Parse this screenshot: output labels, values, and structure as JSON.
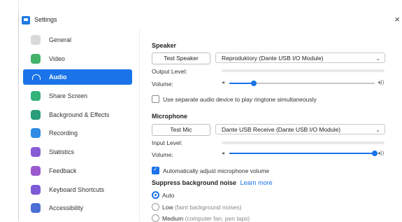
{
  "window": {
    "title": "Settings",
    "close_glyph": "×"
  },
  "sidebar": {
    "items": [
      {
        "label": "General",
        "icon": "gear-icon",
        "color": "#d9d9d9"
      },
      {
        "label": "Video",
        "icon": "video-icon",
        "color": "#42b36a"
      },
      {
        "label": "Audio",
        "icon": "headphones-icon",
        "color": "#1a73e8",
        "active": true
      },
      {
        "label": "Share Screen",
        "icon": "share-screen-icon",
        "color": "#33b37a"
      },
      {
        "label": "Background & Effects",
        "icon": "background-icon",
        "color": "#2a9d7a"
      },
      {
        "label": "Recording",
        "icon": "recording-icon",
        "color": "#2f8be6"
      },
      {
        "label": "Statistics",
        "icon": "statistics-icon",
        "color": "#8a5bd6"
      },
      {
        "label": "Feedback",
        "icon": "feedback-icon",
        "color": "#9b59d0"
      },
      {
        "label": "Keyboard Shortcuts",
        "icon": "keyboard-icon",
        "color": "#7d5bd6"
      },
      {
        "label": "Accessibility",
        "icon": "accessibility-icon",
        "color": "#4c6fd6"
      }
    ]
  },
  "speaker": {
    "section_title": "Speaker",
    "test_button": "Test Speaker",
    "device": "Reproduktory (Dante USB I/O Module)",
    "output_level_label": "Output Level:",
    "output_level": 0.0,
    "volume_label": "Volume:",
    "volume": 0.17,
    "separate_device_label": "Use separate audio device to play ringtone simultaneously",
    "separate_device_checked": false
  },
  "microphone": {
    "section_title": "Microphone",
    "test_button": "Test Mic",
    "device": "Dante USB Receive (Dante USB I/O Module)",
    "input_level_label": "Input Level:",
    "input_level": 0.0,
    "volume_label": "Volume:",
    "volume": 1.0,
    "auto_adjust_label": "Automatically adjust microphone volume",
    "auto_adjust_checked": true
  },
  "noise": {
    "title": "Suppress background noise",
    "learn_more": "Learn more",
    "options": [
      {
        "label": "Auto",
        "hint": "",
        "checked": true
      },
      {
        "label": "Low",
        "hint": "(faint background noises)",
        "checked": false
      },
      {
        "label": "Medium",
        "hint": "(computer fan, pen taps)",
        "checked": false
      }
    ]
  },
  "colors": {
    "accent": "#1a73e8"
  }
}
